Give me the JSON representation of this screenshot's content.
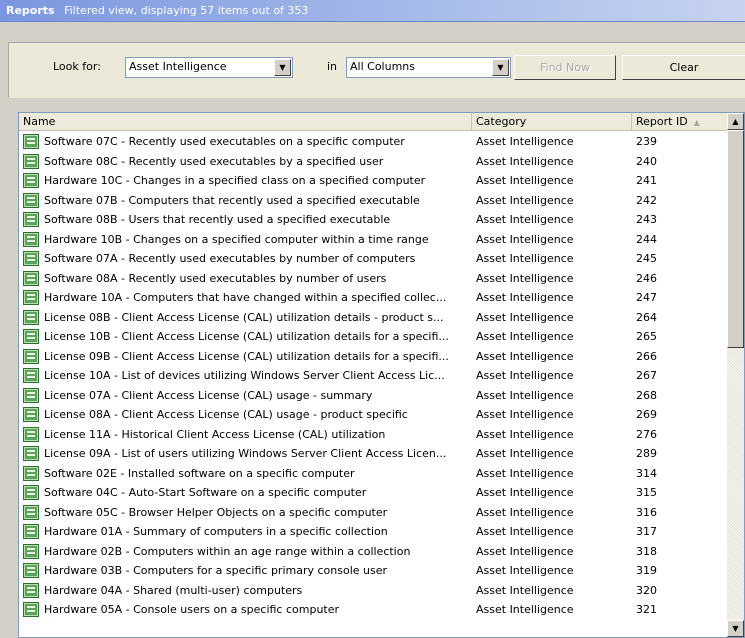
{
  "header": {
    "title": "Reports",
    "subtitle": "Filtered view, displaying 57 items out of 353"
  },
  "search": {
    "look_for_label": "Look for:",
    "look_for_value": "Asset Intelligence",
    "in_label": "in",
    "in_value": "All Columns",
    "find_now_label": "Find Now",
    "clear_label": "Clear"
  },
  "table": {
    "columns": [
      "Name",
      "Category",
      "Report ID"
    ],
    "sort_column": "Report ID",
    "rows": [
      {
        "name": "Software 07C - Recently used executables on a specific computer",
        "category": "Asset Intelligence",
        "id": "239"
      },
      {
        "name": "Software 08C - Recently used executables by a specified user",
        "category": "Asset Intelligence",
        "id": "240"
      },
      {
        "name": "Hardware 10C - Changes in a specified class on a specified computer",
        "category": "Asset Intelligence",
        "id": "241"
      },
      {
        "name": "Software 07B - Computers that recently used a specified executable",
        "category": "Asset Intelligence",
        "id": "242"
      },
      {
        "name": "Software 08B - Users that recently used a specified executable",
        "category": "Asset Intelligence",
        "id": "243"
      },
      {
        "name": "Hardware 10B - Changes on a specified computer within a time range",
        "category": "Asset Intelligence",
        "id": "244"
      },
      {
        "name": "Software 07A - Recently used executables by number of computers",
        "category": "Asset Intelligence",
        "id": "245"
      },
      {
        "name": "Software 08A - Recently used executables by number of users",
        "category": "Asset Intelligence",
        "id": "246"
      },
      {
        "name": "Hardware 10A - Computers that have changed within a specified collec...",
        "category": "Asset Intelligence",
        "id": "247"
      },
      {
        "name": "License 08B - Client Access License (CAL) utilization details -  product s...",
        "category": "Asset Intelligence",
        "id": "264"
      },
      {
        "name": "License 10B - Client Access License (CAL) utilization details for a specifi...",
        "category": "Asset Intelligence",
        "id": "265"
      },
      {
        "name": "License 09B - Client Access License (CAL) utilization details for a specifi...",
        "category": "Asset Intelligence",
        "id": "266"
      },
      {
        "name": "License 10A - List of devices utilizing Windows Server Client Access Lic...",
        "category": "Asset Intelligence",
        "id": "267"
      },
      {
        "name": "License 07A - Client Access License (CAL) usage - summary",
        "category": "Asset Intelligence",
        "id": "268"
      },
      {
        "name": "License 08A - Client Access License (CAL) usage - product specific",
        "category": "Asset Intelligence",
        "id": "269"
      },
      {
        "name": "License 11A - Historical Client Access License (CAL) utilization",
        "category": "Asset Intelligence",
        "id": "276"
      },
      {
        "name": "License 09A - List of users utilizing Windows Server Client Access Licen...",
        "category": "Asset Intelligence",
        "id": "289"
      },
      {
        "name": "Software 02E - Installed software on a specific computer",
        "category": "Asset Intelligence",
        "id": "314"
      },
      {
        "name": "Software 04C - Auto-Start Software on a specific computer",
        "category": "Asset Intelligence",
        "id": "315"
      },
      {
        "name": "Software 05C - Browser Helper Objects on a specific computer",
        "category": "Asset Intelligence",
        "id": "316"
      },
      {
        "name": "Hardware 01A - Summary of computers in a specific collection",
        "category": "Asset Intelligence",
        "id": "317"
      },
      {
        "name": "Hardware 02B - Computers within an age range within a collection",
        "category": "Asset Intelligence",
        "id": "318"
      },
      {
        "name": "Hardware 03B - Computers for a specific primary console user",
        "category": "Asset Intelligence",
        "id": "319"
      },
      {
        "name": "Hardware 04A - Shared (multi-user) computers",
        "category": "Asset Intelligence",
        "id": "320"
      },
      {
        "name": "Hardware 05A - Console users on a specific computer",
        "category": "Asset Intelligence",
        "id": "321"
      }
    ]
  },
  "icons": {
    "row": "report-icon",
    "dropdown": "chevron-down-icon",
    "sort": "sort-ascending-icon"
  },
  "colors": {
    "title_bar": "#7a96df",
    "panel": "#ece9d8",
    "report_icon": "#5aa35a"
  }
}
